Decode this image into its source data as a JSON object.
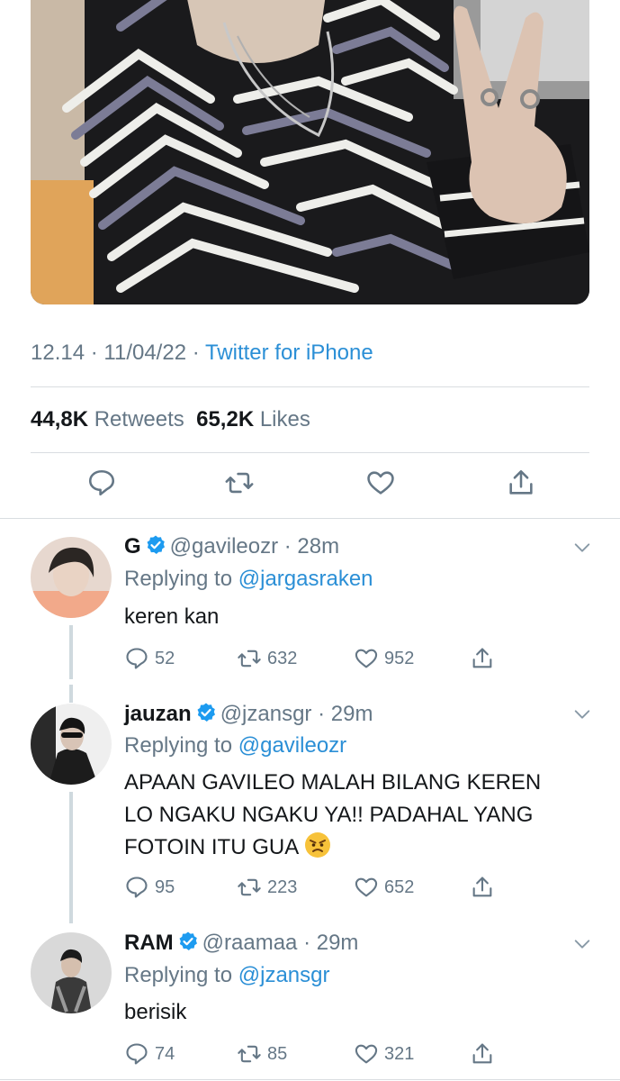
{
  "tweet": {
    "time": "12.14",
    "date": "11/04/22",
    "source": "Twitter for iPhone",
    "retweets_count": "44,8K",
    "retweets_label": "Retweets",
    "likes_count": "65,2K",
    "likes_label": "Likes",
    "sep": "·"
  },
  "colors": {
    "accent": "#2b8fd6",
    "muted": "#657786",
    "divider": "#d9dde1"
  },
  "replies": [
    {
      "name": "G",
      "handle": "@gavileozr",
      "time": "28m",
      "replying_label": "Replying to",
      "replying_to": "@jargasraken",
      "text": "keren kan",
      "replies": "52",
      "retweets": "632",
      "likes": "952"
    },
    {
      "name": "jauzan",
      "handle": "@jzansgr",
      "time": "29m",
      "replying_label": "Replying to",
      "replying_to": "@gavileozr",
      "text_lines": [
        "APAAN GAVILEO MALAH BILANG KEREN",
        "LO NGAKU NGAKU YA!! PADAHAL YANG",
        "FOTOIN ITU GUA"
      ],
      "emoji": "angry-face-emoji",
      "replies": "95",
      "retweets": "223",
      "likes": "652"
    },
    {
      "name": "RAM",
      "handle": "@raamaa",
      "time": "29m",
      "replying_label": "Replying to",
      "replying_to": "@jzansgr",
      "text": "berisik",
      "replies": "74",
      "retweets": "85",
      "likes": "321"
    }
  ]
}
